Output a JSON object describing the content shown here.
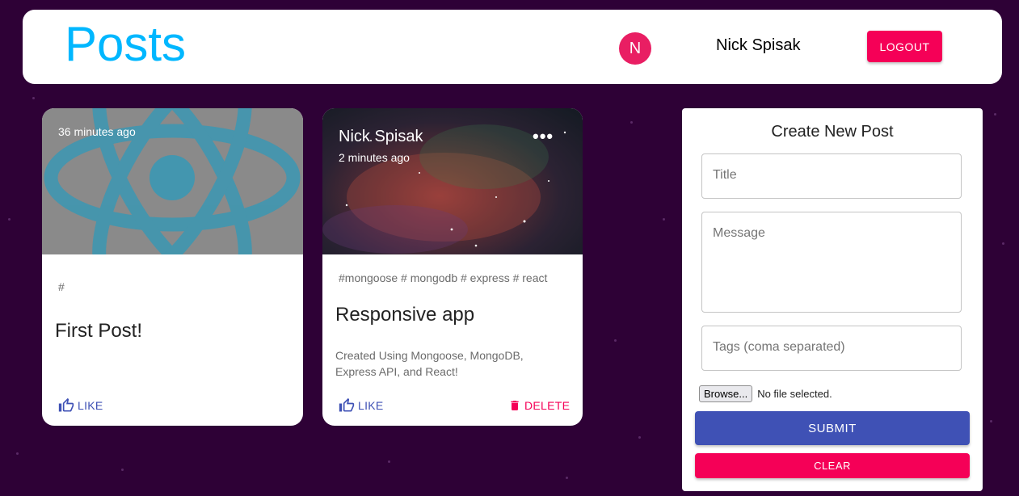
{
  "appbar": {
    "brand": "Posts",
    "avatar_initial": "N",
    "username": "Nick Spisak",
    "logout_label": "LOGOUT"
  },
  "posts": [
    {
      "time": "36 minutes ago",
      "tags": "#",
      "title": "First Post!",
      "like_label": "LIKE",
      "image": "react-logo"
    },
    {
      "author": "Nick Spisak",
      "time": "2 minutes ago",
      "tags": "#mongoose # mongodb # express # react",
      "title": "Responsive app",
      "message": "Created Using Mongoose, MongoDB, Express API, and React!",
      "like_label": "LIKE",
      "delete_label": "DELETE",
      "more_icon": "•••",
      "image": "galaxy-photo"
    }
  ],
  "form": {
    "heading": "Create New Post",
    "title_placeholder": "Title",
    "message_placeholder": "Message",
    "tags_placeholder": "Tags (coma separated)",
    "browse_label": "Browse...",
    "file_status": "No file selected.",
    "submit_label": "SUBMIT",
    "clear_label": "CLEAR"
  },
  "colors": {
    "background": "#2e0136",
    "brand": "#00b7ff",
    "primary": "#3f51b5",
    "secondary": "#f50057",
    "avatar": "#e91e63"
  }
}
